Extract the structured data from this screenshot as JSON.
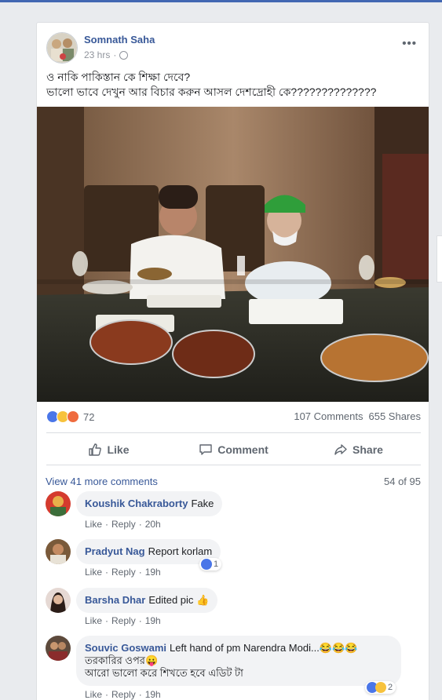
{
  "post": {
    "author": "Somnath Saha",
    "time": "23 hrs",
    "more_label": "•••",
    "text_line1": "ও নাকি পাকিস্তান কে শিক্ষা দেবে?",
    "text_line2": "ভালো ভাবে দেখুন আর বিচার করুন আসল দেশদ্রোহী কে??????????????"
  },
  "stats": {
    "reaction_count": "72",
    "comments": "107 Comments",
    "shares": "655 Shares"
  },
  "actions": {
    "like": "Like",
    "comment": "Comment",
    "share": "Share"
  },
  "comments_section": {
    "view_more": "View 41 more comments",
    "counter": "54 of 95",
    "items": [
      {
        "name": "Koushik Chakraborty",
        "text": "Fake",
        "like": "Like",
        "reply": "Reply",
        "time": "20h"
      },
      {
        "name": "Pradyut Nag",
        "text": "Report korlam",
        "like": "Like",
        "reply": "Reply",
        "time": "19h",
        "reactions": "1"
      },
      {
        "name": "Barsha Dhar",
        "text": "Edited pic 👍",
        "like": "Like",
        "reply": "Reply",
        "time": "19h"
      },
      {
        "name": "Souvic Goswami",
        "text_line1": "Left hand of pm Narendra Modi...😂😂😂",
        "text_line2": "তরকারির ওপর😛",
        "text_line3": "আরো ভালো করে শিখতে হবে এডিট টা",
        "like": "Like",
        "reply": "Reply",
        "time": "19h",
        "reactions": "2"
      }
    ]
  },
  "colors": {
    "link": "#385898",
    "brand": "#4267b2",
    "muted": "#606770",
    "bubble": "#f2f3f5"
  }
}
